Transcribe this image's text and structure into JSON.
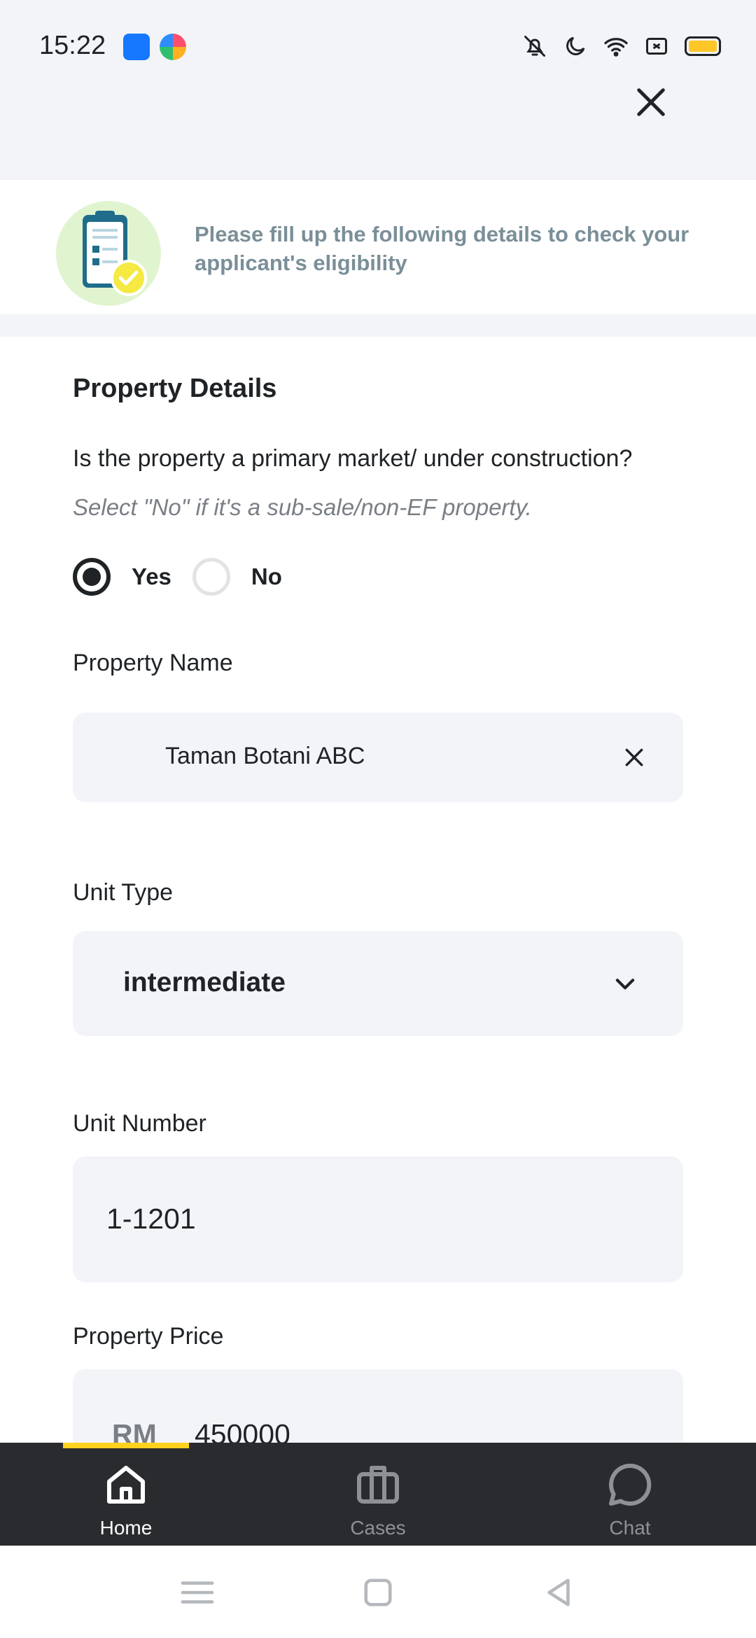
{
  "status_bar": {
    "time": "15:22"
  },
  "colors": {
    "accent": "#ffd21f",
    "dark": "#1f2326",
    "field_bg": "#f2f4f8",
    "banner_text": "#7a8f98",
    "nav_bg": "#2a2b2e"
  },
  "banner": {
    "text": "Please fill up the following details to check your applicant's eligibility"
  },
  "form": {
    "section_title": "Property Details",
    "question": "Is the property a primary market/ under construction?",
    "hint": "Select \"No\" if it's a sub-sale/non-EF property.",
    "radio": {
      "yes_label": "Yes",
      "no_label": "No",
      "selected": "Yes"
    },
    "property_name": {
      "label": "Property Name",
      "value": "Taman Botani ABC"
    },
    "unit_type": {
      "label": "Unit Type",
      "value": "intermediate"
    },
    "unit_number": {
      "label": "Unit Number",
      "value": "1-1201"
    },
    "property_price": {
      "label": "Property Price",
      "currency": "RM",
      "value": "450000"
    }
  },
  "bottom_nav": {
    "items": [
      {
        "label": "Home",
        "icon": "home-icon",
        "active": true
      },
      {
        "label": "Cases",
        "icon": "briefcase-icon",
        "active": false
      },
      {
        "label": "Chat",
        "icon": "chat-bubble-icon",
        "active": false
      }
    ]
  }
}
